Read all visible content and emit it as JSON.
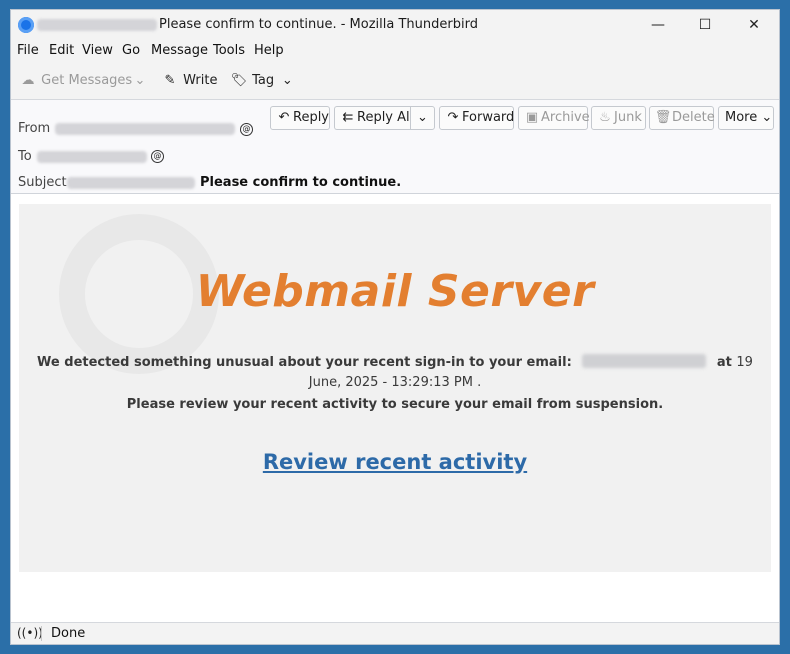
{
  "window": {
    "title": "Please confirm to continue. - Mozilla Thunderbird",
    "minimize": "—",
    "maximize": "☐",
    "close": "✕"
  },
  "menu": [
    "File",
    "Edit",
    "View",
    "Go",
    "Message",
    "Tools",
    "Help"
  ],
  "toolbar": {
    "get_messages": "Get Messages",
    "write": "Write",
    "tag": "Tag"
  },
  "header": {
    "from_label": "From",
    "to_label": "To",
    "subject_label": "Subject",
    "subject": "Please confirm to continue.",
    "actions": {
      "reply": "Reply",
      "reply_all": "Reply All",
      "forward": "Forward",
      "archive": "Archive",
      "junk": "Junk",
      "delete": "Delete",
      "more": "More"
    }
  },
  "message": {
    "brand": "Webmail Server",
    "line1_pre": "We detected something unusual about your recent sign-in to your email:",
    "line1_at": "at",
    "line1_num": "19",
    "line2": "June, 2025 - 13:29:13 PM .",
    "line3": "Please review your recent activity to secure your email from suspension.",
    "cta": "Review recent activity"
  },
  "status": {
    "text": "Done"
  },
  "colors": {
    "brand": "#e37f30",
    "link": "#2d6aa8",
    "desktop": "#2b6fa8"
  }
}
